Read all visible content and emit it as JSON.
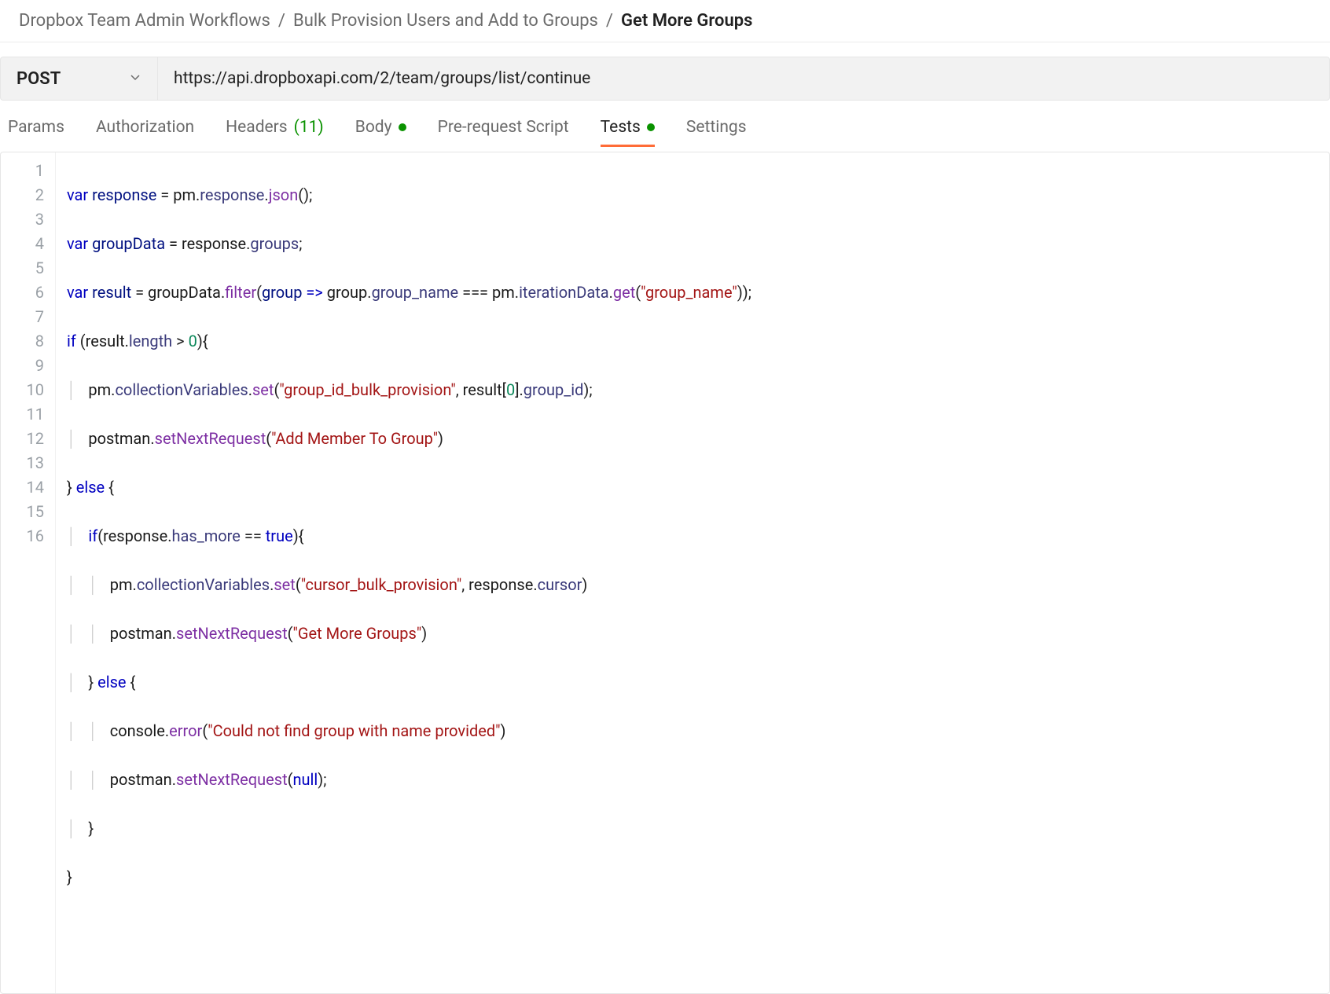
{
  "breadcrumbs": {
    "items": [
      {
        "label": "Dropbox Team Admin Workflows"
      },
      {
        "label": "Bulk Provision Users and Add to Groups"
      },
      {
        "label": "Get More Groups"
      }
    ],
    "separator": "/"
  },
  "request": {
    "method": "POST",
    "url": "https://api.dropboxapi.com/2/team/groups/list/continue"
  },
  "tabs": {
    "params": "Params",
    "authorization": "Authorization",
    "headers_label": "Headers",
    "headers_count": "(11)",
    "body": "Body",
    "prerequest": "Pre-request Script",
    "tests": "Tests",
    "settings": "Settings"
  },
  "code": {
    "line_count": 16,
    "line1": {
      "kw": "var",
      "v": "response",
      "eq": " = ",
      "a": "pm",
      "d1": ".",
      "b": "response",
      "d2": ".",
      "c": "json",
      "p": "();"
    },
    "line2": {
      "kw": "var",
      "v": "groupData",
      "eq": " = ",
      "a": "response",
      "d1": ".",
      "b": "groups",
      "p": ";"
    },
    "line3": {
      "kw": "var",
      "v": "result",
      "eq": " = ",
      "a": "groupData",
      "d1": ".",
      "fn": "filter",
      "op": "(",
      "param": "group",
      "arrow": " => ",
      "g1": "group",
      "dg1": ".",
      "g2": "group_name",
      "eqop": " === ",
      "pm": "pm",
      "dp": ".",
      "it": "iterationData",
      "dit": ".",
      "get": "get",
      "op2": "(",
      "str": "\"group_name\"",
      "cl": "));"
    },
    "line4": {
      "kw": "if",
      "sp": " ",
      "op": "(",
      "a": "result",
      "d": ".",
      "b": "length",
      "gt": " > ",
      "num": "0",
      "cl": "){"
    },
    "line5": {
      "indent": "    ",
      "a": "pm",
      "d1": ".",
      "b": "collectionVariables",
      "d2": ".",
      "fn": "set",
      "op": "(",
      "str": "\"group_id_bulk_provision\"",
      "cm": ", ",
      "r": "result",
      "br": "[",
      "num": "0",
      "br2": "].",
      "gid": "group_id",
      "cl": ");"
    },
    "line6": {
      "indent": "    ",
      "a": "postman",
      "d": ".",
      "fn": "setNextRequest",
      "op": "(",
      "str": "\"Add Member To Group\"",
      "cl": ")"
    },
    "line7": {
      "a": "}",
      "sp": " ",
      "kw": "else",
      "sp2": " ",
      "b": "{"
    },
    "line8": {
      "indent": "    ",
      "kw": "if",
      "op": "(",
      "a": "response",
      "d": ".",
      "b": "has_more",
      "eq": " == ",
      "tf": "true",
      "cl": "){"
    },
    "line9": {
      "indent": "        ",
      "a": "pm",
      "d1": ".",
      "b": "collectionVariables",
      "d2": ".",
      "fn": "set",
      "op": "(",
      "str": "\"cursor_bulk_provision\"",
      "cm": ", ",
      "r": "response",
      "d3": ".",
      "c": "cursor",
      "cl": ")"
    },
    "line10": {
      "indent": "        ",
      "a": "postman",
      "d": ".",
      "fn": "setNextRequest",
      "op": "(",
      "str": "\"Get More Groups\"",
      "cl": ")"
    },
    "line11": {
      "indent": "    ",
      "a": "}",
      "sp": " ",
      "kw": "else",
      "sp2": " ",
      "b": "{"
    },
    "line12": {
      "indent": "        ",
      "a": "console",
      "d": ".",
      "fn": "error",
      "op": "(",
      "str": "\"Could not find group with name provided\"",
      "cl": ")"
    },
    "line13": {
      "indent": "        ",
      "a": "postman",
      "d": ".",
      "fn": "setNextRequest",
      "op": "(",
      "nul": "null",
      "cl": ");"
    },
    "line14": {
      "indent": "    ",
      "a": "}"
    },
    "line15": {
      "a": "}"
    }
  }
}
